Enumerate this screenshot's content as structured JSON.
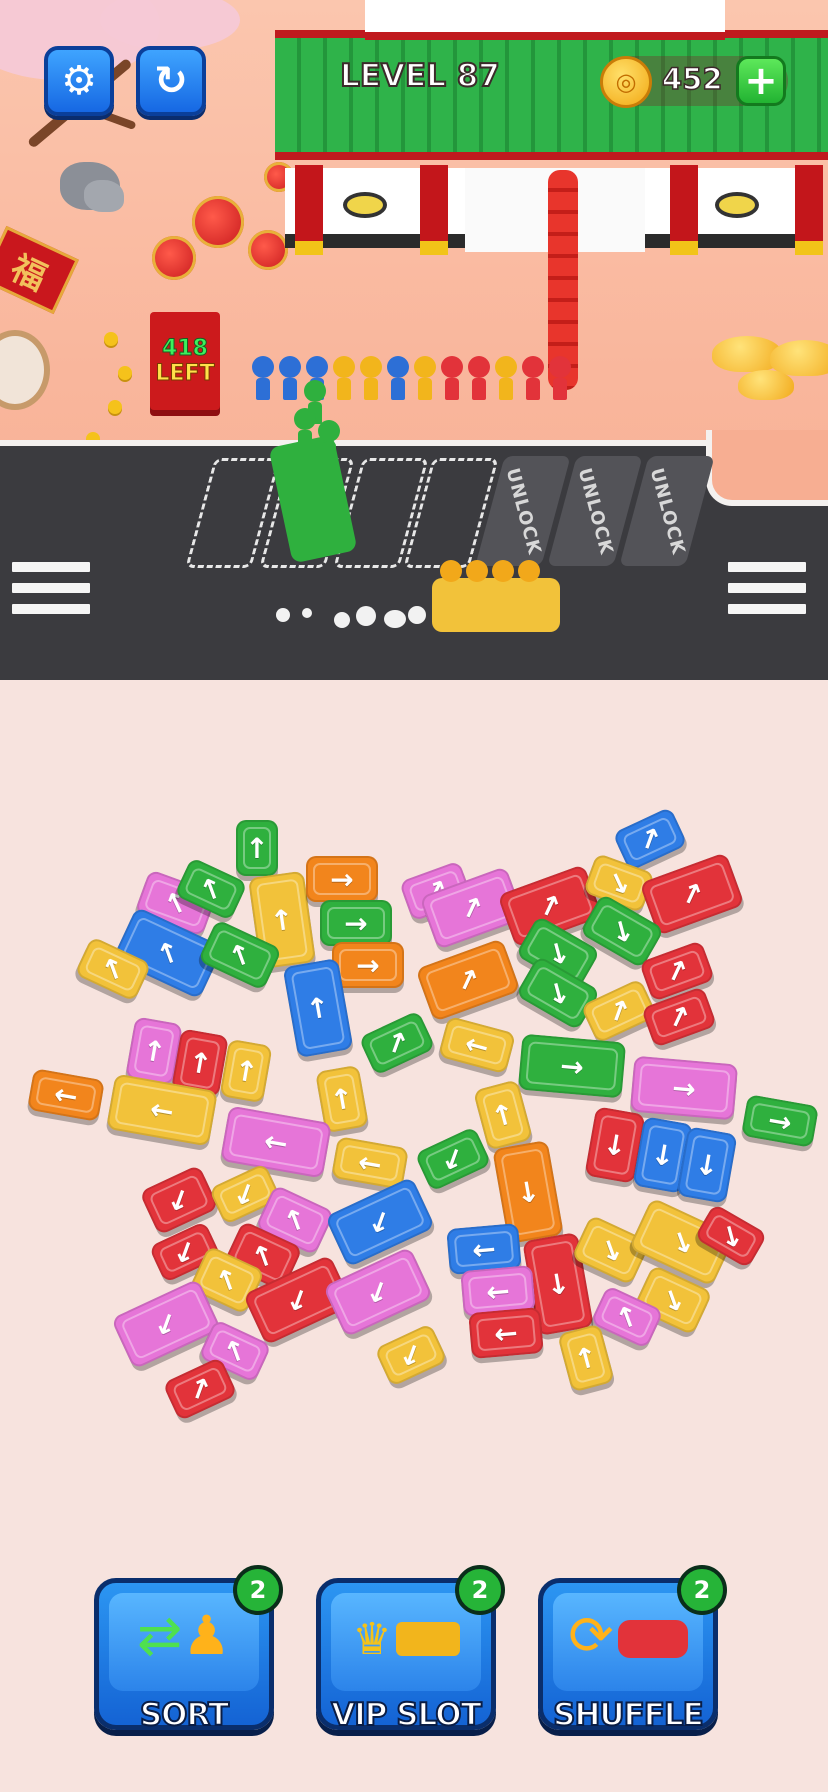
{
  "hud": {
    "level": "LEVEL 87",
    "coins": "452",
    "settings_icon": "gear-icon",
    "restart_icon": "refresh-icon",
    "add_coins_icon": "plus-icon"
  },
  "scene": {
    "remaining_count": "418",
    "remaining_label": "LEFT",
    "banner_char": "福",
    "locked_slot_label": "UNLOCK"
  },
  "boosters": [
    {
      "label": "SORT",
      "count": "2",
      "icon": "sort-person-icon"
    },
    {
      "label": "VIP SLOT",
      "count": "2",
      "icon": "vip-bus-icon"
    },
    {
      "label": "SHUFFLE",
      "count": "2",
      "icon": "shuffle-car-icon"
    }
  ],
  "colors": {
    "red": "#e2333a",
    "blue": "#2f7de6",
    "green": "#2fb03e",
    "yellow": "#f2c23a",
    "orange": "#f2851c",
    "pink": "#e675d8"
  }
}
